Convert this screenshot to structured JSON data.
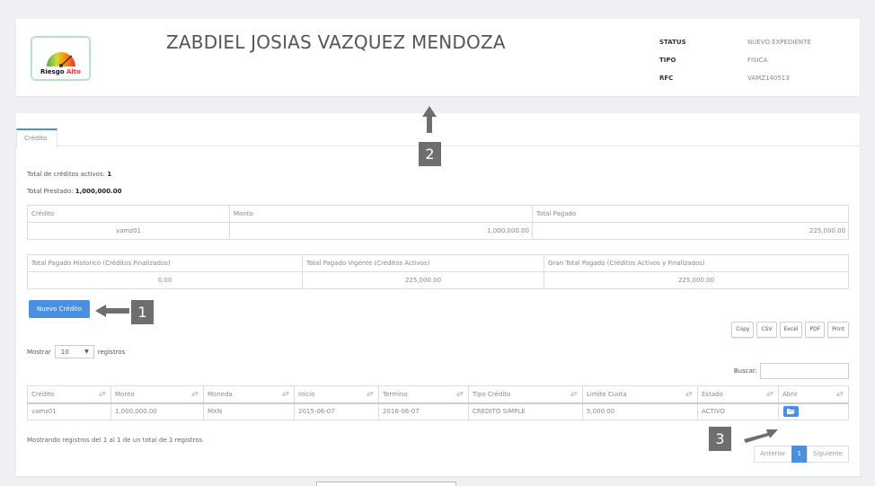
{
  "header": {
    "risk_label_prefix": "Riesgo ",
    "risk_label_level": "Alto",
    "client_name": "ZABDIEL JOSIAS VAZQUEZ MENDOZA",
    "info": [
      {
        "key": "STATUS",
        "value": "NUEVO EXPEDIENTE"
      },
      {
        "key": "TIPO",
        "value": "FISICA"
      },
      {
        "key": "RFC",
        "value": "VAMZ140513"
      }
    ]
  },
  "tabs": [
    {
      "label": "Crédito",
      "active": true
    }
  ],
  "credit": {
    "active_label": "Total de créditos activos: ",
    "active_value": "1",
    "lent_label": "Total Prestado: ",
    "lent_value": "1,000,000.00",
    "summary": {
      "headers": [
        "Crédito",
        "Monto",
        "Total Pagado"
      ],
      "row": [
        "vamz01",
        "1,000,000.00",
        "225,000.00"
      ]
    },
    "historic": {
      "headers": [
        "Total Pagado Historico (Créditos Finalizados)",
        "Total Pagado Vigente (Créditos Activos)",
        "Gran Total Pagado (Créditos Activos y Finalizados)"
      ],
      "row": [
        "0.00",
        "225,000.00",
        "225,000.00"
      ]
    },
    "new_button": "Nuevo Crédito",
    "export_buttons": [
      "Copy",
      "CSV",
      "Excel",
      "PDF",
      "Print"
    ],
    "length": {
      "prefix": "Mostrar",
      "value": "10",
      "suffix": "registros"
    },
    "search_label": "Buscar:",
    "table": {
      "headers": [
        "Crédito",
        "Monto",
        "Moneda",
        "Inicio",
        "Termino",
        "Tipo Crédito",
        "Limite Cuota",
        "Estado",
        "Abrir"
      ],
      "rows": [
        [
          "vamz01",
          "1,000,000.00",
          "MXN",
          "2015-06-07",
          "2016-06-07",
          "CREDITO SIMPLE",
          "5,000.00",
          "ACTIVO"
        ]
      ]
    },
    "footer_info": "Mostrando registros del 1 al 1 de un total de 1 registros",
    "pagination": {
      "prev": "Anterior",
      "current": "1",
      "next": "Siguiente"
    }
  },
  "callouts": [
    "1",
    "2",
    "3"
  ],
  "colors": {
    "accent": "#4a90e2",
    "callout": "#6e6e6e",
    "risk_high": "#e53935"
  }
}
